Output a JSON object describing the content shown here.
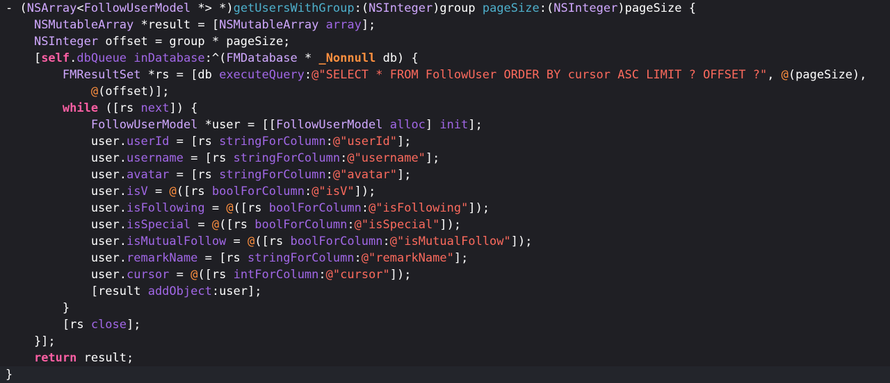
{
  "colors": {
    "background": "#1f1f24",
    "plain": "#ffffff",
    "keyword": "#fc5fa3",
    "type": "#d0a8ff",
    "method": "#a167e6",
    "method_decl": "#4eb0cc",
    "string": "#fc6a5d",
    "boxed_literal": "#fd8f3f"
  },
  "code_lines": [
    [
      [
        "plain",
        "- ("
      ],
      [
        "type",
        "NSArray"
      ],
      [
        "plain",
        "<"
      ],
      [
        "type",
        "FollowUserModel"
      ],
      [
        "plain",
        " *> *)"
      ],
      [
        "method2",
        "getUsersWithGroup"
      ],
      [
        "plain",
        ":("
      ],
      [
        "type",
        "NSInteger"
      ],
      [
        "plain",
        ")group "
      ],
      [
        "method2",
        "pageSize"
      ],
      [
        "plain",
        ":("
      ],
      [
        "type",
        "NSInteger"
      ],
      [
        "plain",
        ")pageSize {"
      ]
    ],
    [
      [
        "plain",
        "    "
      ],
      [
        "type",
        "NSMutableArray"
      ],
      [
        "plain",
        " *result = ["
      ],
      [
        "type",
        "NSMutableArray"
      ],
      [
        "plain",
        " "
      ],
      [
        "method",
        "array"
      ],
      [
        "plain",
        "];"
      ]
    ],
    [
      [
        "plain",
        "    "
      ],
      [
        "type",
        "NSInteger"
      ],
      [
        "plain",
        " offset = group * pageSize;"
      ]
    ],
    [
      [
        "plain",
        "    ["
      ],
      [
        "kw",
        "self"
      ],
      [
        "plain",
        "."
      ],
      [
        "prop",
        "dbQueue"
      ],
      [
        "plain",
        " "
      ],
      [
        "method",
        "inDatabase"
      ],
      [
        "plain",
        ":^("
      ],
      [
        "type",
        "FMDatabase"
      ],
      [
        "plain",
        " * "
      ],
      [
        "nullattr",
        "_Nonnull"
      ],
      [
        "plain",
        " db) {"
      ]
    ],
    [
      [
        "plain",
        "        "
      ],
      [
        "type",
        "FMResultSet"
      ],
      [
        "plain",
        " *rs = [db "
      ],
      [
        "method",
        "executeQuery"
      ],
      [
        "plain",
        ":"
      ],
      [
        "str",
        "@\"SELECT * FROM FollowUser ORDER BY cursor ASC LIMIT ? OFFSET ?\""
      ],
      [
        "plain",
        ", "
      ],
      [
        "boxat",
        "@"
      ],
      [
        "plain",
        "(pageSize),"
      ]
    ],
    [
      [
        "plain",
        "            "
      ],
      [
        "boxat",
        "@"
      ],
      [
        "plain",
        "(offset)];"
      ]
    ],
    [
      [
        "plain",
        "        "
      ],
      [
        "kw",
        "while"
      ],
      [
        "plain",
        " ([rs "
      ],
      [
        "method",
        "next"
      ],
      [
        "plain",
        "]) {"
      ]
    ],
    [
      [
        "plain",
        "            "
      ],
      [
        "type",
        "FollowUserModel"
      ],
      [
        "plain",
        " *user = [["
      ],
      [
        "type",
        "FollowUserModel"
      ],
      [
        "plain",
        " "
      ],
      [
        "method",
        "alloc"
      ],
      [
        "plain",
        "] "
      ],
      [
        "method",
        "init"
      ],
      [
        "plain",
        "];"
      ]
    ],
    [
      [
        "plain",
        "            user."
      ],
      [
        "prop",
        "userId"
      ],
      [
        "plain",
        " = [rs "
      ],
      [
        "method",
        "stringForColumn"
      ],
      [
        "plain",
        ":"
      ],
      [
        "str",
        "@\"userId\""
      ],
      [
        "plain",
        "];"
      ]
    ],
    [
      [
        "plain",
        "            user."
      ],
      [
        "prop",
        "username"
      ],
      [
        "plain",
        " = [rs "
      ],
      [
        "method",
        "stringForColumn"
      ],
      [
        "plain",
        ":"
      ],
      [
        "str",
        "@\"username\""
      ],
      [
        "plain",
        "];"
      ]
    ],
    [
      [
        "plain",
        "            user."
      ],
      [
        "prop",
        "avatar"
      ],
      [
        "plain",
        " = [rs "
      ],
      [
        "method",
        "stringForColumn"
      ],
      [
        "plain",
        ":"
      ],
      [
        "str",
        "@\"avatar\""
      ],
      [
        "plain",
        "];"
      ]
    ],
    [
      [
        "plain",
        "            user."
      ],
      [
        "prop",
        "isV"
      ],
      [
        "plain",
        " = "
      ],
      [
        "boxat",
        "@"
      ],
      [
        "plain",
        "([rs "
      ],
      [
        "method",
        "boolForColumn"
      ],
      [
        "plain",
        ":"
      ],
      [
        "str",
        "@\"isV\""
      ],
      [
        "plain",
        "]);"
      ]
    ],
    [
      [
        "plain",
        "            user."
      ],
      [
        "prop",
        "isFollowing"
      ],
      [
        "plain",
        " = "
      ],
      [
        "boxat",
        "@"
      ],
      [
        "plain",
        "([rs "
      ],
      [
        "method",
        "boolForColumn"
      ],
      [
        "plain",
        ":"
      ],
      [
        "str",
        "@\"isFollowing\""
      ],
      [
        "plain",
        "]);"
      ]
    ],
    [
      [
        "plain",
        "            user."
      ],
      [
        "prop",
        "isSpecial"
      ],
      [
        "plain",
        " = "
      ],
      [
        "boxat",
        "@"
      ],
      [
        "plain",
        "([rs "
      ],
      [
        "method",
        "boolForColumn"
      ],
      [
        "plain",
        ":"
      ],
      [
        "str",
        "@\"isSpecial\""
      ],
      [
        "plain",
        "]);"
      ]
    ],
    [
      [
        "plain",
        "            user."
      ],
      [
        "prop",
        "isMutualFollow"
      ],
      [
        "plain",
        " = "
      ],
      [
        "boxat",
        "@"
      ],
      [
        "plain",
        "([rs "
      ],
      [
        "method",
        "boolForColumn"
      ],
      [
        "plain",
        ":"
      ],
      [
        "str",
        "@\"isMutualFollow\""
      ],
      [
        "plain",
        "]);"
      ]
    ],
    [
      [
        "plain",
        "            user."
      ],
      [
        "prop",
        "remarkName"
      ],
      [
        "plain",
        " = [rs "
      ],
      [
        "method",
        "stringForColumn"
      ],
      [
        "plain",
        ":"
      ],
      [
        "str",
        "@\"remarkName\""
      ],
      [
        "plain",
        "];"
      ]
    ],
    [
      [
        "plain",
        "            user."
      ],
      [
        "prop",
        "cursor"
      ],
      [
        "plain",
        " = "
      ],
      [
        "boxat",
        "@"
      ],
      [
        "plain",
        "([rs "
      ],
      [
        "method",
        "intForColumn"
      ],
      [
        "plain",
        ":"
      ],
      [
        "str",
        "@\"cursor\""
      ],
      [
        "plain",
        "]);"
      ]
    ],
    [
      [
        "plain",
        "            [result "
      ],
      [
        "method",
        "addObject"
      ],
      [
        "plain",
        ":user];"
      ]
    ],
    [
      [
        "plain",
        "        }"
      ]
    ],
    [
      [
        "plain",
        "        [rs "
      ],
      [
        "method",
        "close"
      ],
      [
        "plain",
        "];"
      ]
    ],
    [
      [
        "plain",
        "    }];"
      ]
    ],
    [
      [
        "plain",
        "    "
      ],
      [
        "kw",
        "return"
      ],
      [
        "plain",
        " result;"
      ]
    ],
    [
      [
        "plain",
        "}"
      ]
    ]
  ],
  "current_line": 23
}
